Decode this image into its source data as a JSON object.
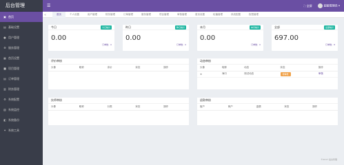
{
  "app": {
    "title": "后台管理"
  },
  "sidebar": {
    "items": [
      {
        "label": "首页",
        "icon": "home-icon",
        "glyph": "▣"
      },
      {
        "label": "基础设置",
        "icon": "list-icon",
        "glyph": "▤"
      },
      {
        "label": "用户管理",
        "icon": "user-icon",
        "glyph": "●"
      },
      {
        "label": "服务管理",
        "icon": "settings-icon",
        "glyph": "⚙"
      },
      {
        "label": "首页设置",
        "icon": "grid-icon",
        "glyph": "▦"
      },
      {
        "label": "项目管理",
        "icon": "folder-icon",
        "glyph": "■"
      },
      {
        "label": "订单管理",
        "icon": "document-icon",
        "glyph": "▤"
      },
      {
        "label": "财务管理",
        "icon": "wallet-icon",
        "glyph": "▥"
      },
      {
        "label": "系统配置",
        "icon": "gear-icon",
        "glyph": "⚙"
      },
      {
        "label": "系统监控",
        "icon": "monitor-icon",
        "glyph": "▧"
      },
      {
        "label": "系统备份",
        "icon": "backup-icon",
        "glyph": "◧"
      },
      {
        "label": "系统工具",
        "icon": "tool-icon",
        "glyph": "✦"
      }
    ]
  },
  "header": {
    "menu_icon": "☰",
    "fullscreen_label": "全屏",
    "user_label": "超级管理员"
  },
  "tabs": [
    {
      "label": "首页",
      "active": true
    },
    {
      "label": "个人设置"
    },
    {
      "label": "用户管理"
    },
    {
      "label": "财务管理"
    },
    {
      "label": "订单管理"
    },
    {
      "label": "服务管理"
    },
    {
      "label": "项目管理"
    },
    {
      "label": "审核管理"
    },
    {
      "label": "首页设置"
    },
    {
      "label": "轮播管理"
    },
    {
      "label": "系统配置"
    },
    {
      "label": "权限管理"
    }
  ],
  "tab_arrow": "«",
  "stats": [
    {
      "title": "今日",
      "badge": "今日统计",
      "value": "0.00",
      "foot_left": "",
      "foot_right": "订单数：0"
    },
    {
      "title": "昨日",
      "badge": "昨日统计",
      "value": "0.00",
      "foot_left": "",
      "foot_right": "订单数：0"
    },
    {
      "title": "本月",
      "badge": "本月统计",
      "value": "0.00",
      "foot_left": "",
      "foot_right": "订单数：0"
    },
    {
      "title": "全部",
      "badge": "全部统计",
      "value": "697.00",
      "foot_left": "",
      "foot_right": "订单数：8"
    }
  ],
  "panels": {
    "review": {
      "title": "评价审核",
      "columns": [
        "头像",
        "昵称",
        "评价",
        "状态",
        "操作"
      ],
      "rows": []
    },
    "dynamic": {
      "title": "动态审核",
      "columns": [
        "头像",
        "昵称",
        "动态",
        "状态",
        "操作"
      ],
      "rows": [
        {
          "avatar": "★",
          "name": "海口",
          "content": "测试动态",
          "status": "待审核",
          "action": "审核"
        }
      ]
    },
    "skill": {
      "title": "技师审核",
      "columns": [
        "头像",
        "昵称",
        "分类",
        "状态",
        "操作"
      ],
      "rows": []
    },
    "refund": {
      "title": "退款审核",
      "columns": [
        "客户",
        "商户",
        "金额",
        "状态",
        "操作"
      ],
      "rows": []
    }
  },
  "footer": "©2017 后台管理"
}
